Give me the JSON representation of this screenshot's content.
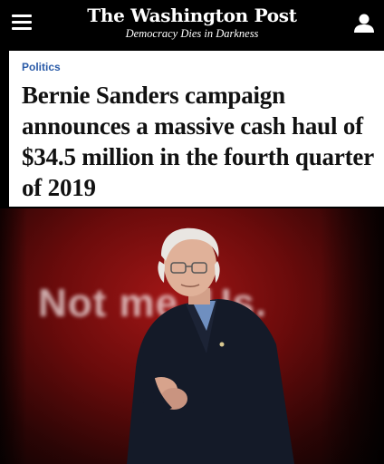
{
  "masthead": {
    "logo": "The Washington Post",
    "tagline": "Democracy Dies in Darkness",
    "menu_icon": "hamburger-menu-icon",
    "account_icon": "user-account-icon"
  },
  "article": {
    "section": "Politics",
    "headline": "Bernie Sanders campaign announces a massive cash haul of $34.5 million in the fourth quarter of 2019"
  },
  "photo": {
    "backdrop_text": "Not me. Us."
  },
  "colors": {
    "masthead_bg": "#000000",
    "kicker": "#2a5ba8",
    "photo_bg": "#8b1010"
  }
}
